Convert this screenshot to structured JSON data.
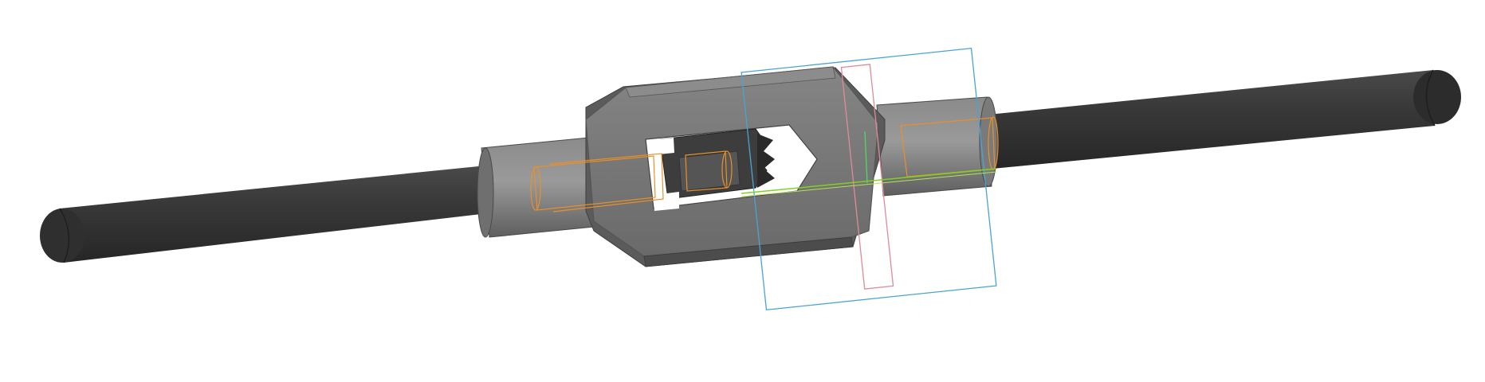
{
  "viewport": {
    "background": "#ffffff"
  },
  "model": {
    "part": "tap-wrench",
    "colors": {
      "handle_dark": "#2e2e2e",
      "handle_mid": "#3c3c3c",
      "body_light": "#7c7c7c",
      "body_face": "#6e6e6e",
      "body_edge": "#5a5a5a",
      "jaw_dark": "#3f3f3f"
    }
  },
  "overlays": {
    "sketch_plane_color": "#4aa3d6",
    "reference_plane_color": "#e08a9a",
    "hidden_edge_color": "#e8902a",
    "axis_x_color": "#7ed321",
    "axis_y_color": "#4cd964"
  }
}
